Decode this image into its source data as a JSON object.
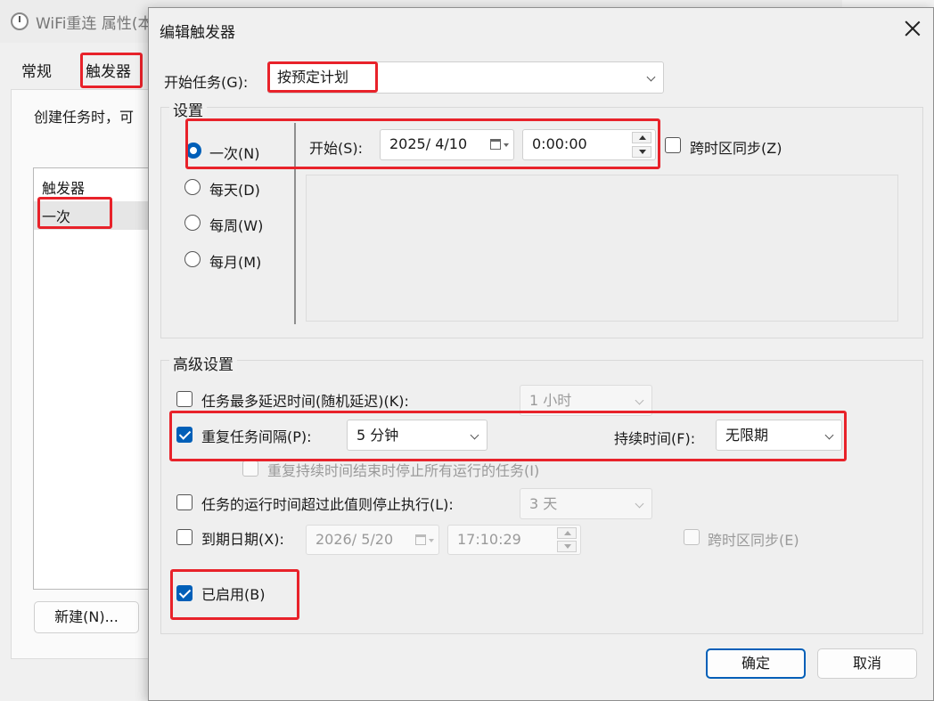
{
  "background_window": {
    "title": "WiFi重连 属性(本",
    "tabs": [
      "常规",
      "触发器"
    ],
    "description": "创建任务时，可",
    "list_header": "触发器",
    "list_item": "一次",
    "new_button": "新建(N)..."
  },
  "dialog": {
    "title": "编辑触发器",
    "begin_task_label": "开始任务(G):",
    "begin_task_value": "按预定计划",
    "settings": {
      "group_title": "设置",
      "options": [
        "一次(N)",
        "每天(D)",
        "每周(W)",
        "每月(M)"
      ],
      "selected": "一次(N)",
      "start_label": "开始(S):",
      "start_date": "2025/  4/10",
      "start_time": "0:00:00",
      "sync_label": "跨时区同步(Z)"
    },
    "advanced": {
      "group_title": "高级设置",
      "delay_label": "任务最多延迟时间(随机延迟)(K):",
      "delay_value": "1 小时",
      "repeat_label": "重复任务间隔(P):",
      "repeat_value": "5 分钟",
      "duration_label": "持续时间(F):",
      "duration_value": "无限期",
      "stop_all_label": "重复持续时间结束时停止所有运行的任务(I)",
      "stop_longer_label": "任务的运行时间超过此值则停止执行(L):",
      "stop_longer_value": "3 天",
      "expire_label": "到期日期(X):",
      "expire_date": "2026/  5/20",
      "expire_time": "17:10:29",
      "expire_sync_label": "跨时区同步(E)",
      "enabled_label": "已启用(B)"
    },
    "ok_button": "确定",
    "cancel_button": "取消"
  },
  "colors": {
    "accent": "#005fb8",
    "highlight": "#e8222a"
  }
}
